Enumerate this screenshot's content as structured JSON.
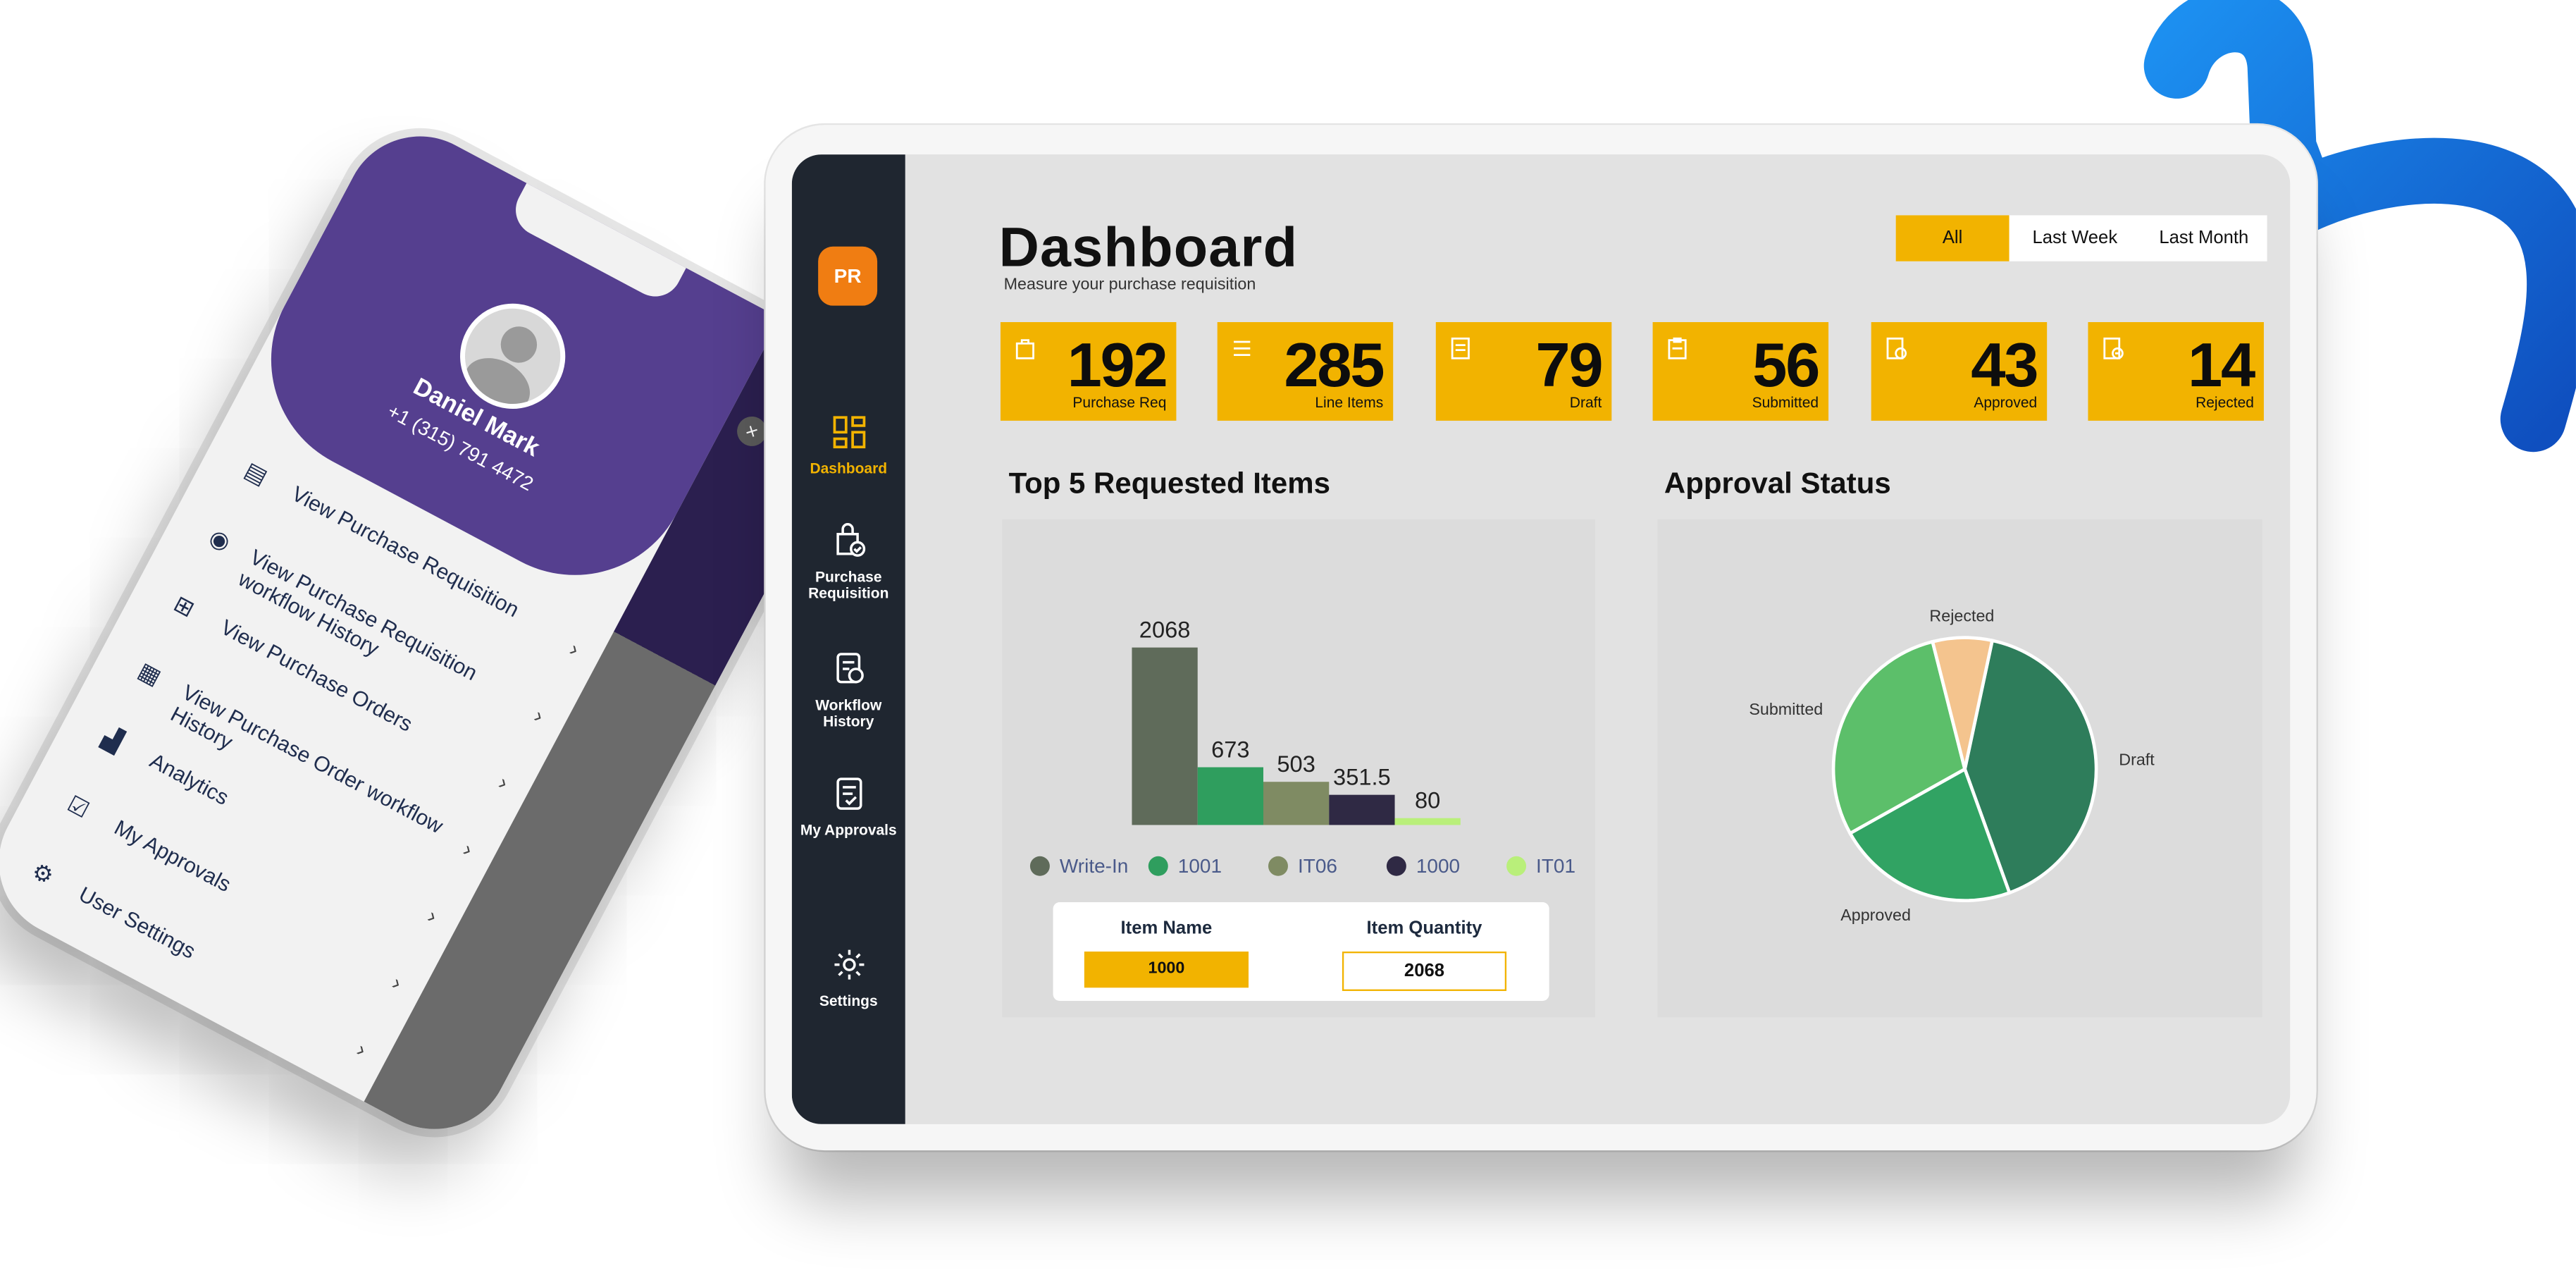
{
  "phone": {
    "user_name": "Daniel Mark",
    "user_phone": "+1 (315) 791 4472",
    "menu": [
      {
        "label": "View Purchase Requisition",
        "icon": "document-search-icon"
      },
      {
        "label": "View Purchase Requisition workflow History",
        "icon": "eye-icon"
      },
      {
        "label": "View Purchase Orders",
        "icon": "cart-icon"
      },
      {
        "label": "View Purchase Order workflow History",
        "icon": "receipt-icon"
      },
      {
        "label": "Analytics",
        "icon": "chart-icon"
      },
      {
        "label": "My Approvals",
        "icon": "approvals-icon"
      },
      {
        "label": "User Settings",
        "icon": "gear-icon"
      }
    ]
  },
  "tablet": {
    "logo": "PR",
    "nav": [
      {
        "label": "Dashboard",
        "icon": "dashboard-icon",
        "active": true
      },
      {
        "label": "Purchase Requisition",
        "icon": "bag-check-icon",
        "active": false
      },
      {
        "label": "Workflow History",
        "icon": "workflow-icon",
        "active": false
      },
      {
        "label": "My Approvals",
        "icon": "approvals-icon",
        "active": false
      },
      {
        "label": "Settings",
        "icon": "gear-icon",
        "active": false
      }
    ],
    "title": "Dashboard",
    "subtitle": "Measure your purchase requisition",
    "filters": [
      "All",
      "Last Week",
      "Last Month"
    ],
    "active_filter": "All",
    "kpis": [
      {
        "value": "192",
        "label": "Purchase Req"
      },
      {
        "value": "285",
        "label": "Line Items"
      },
      {
        "value": "79",
        "label": "Draft"
      },
      {
        "value": "56",
        "label": "Submitted"
      },
      {
        "value": "43",
        "label": "Approved"
      },
      {
        "value": "14",
        "label": "Rejected"
      }
    ],
    "bar_section_title": "Top 5 Requested Items",
    "pie_section_title": "Approval Status",
    "item_card": {
      "name_header": "Item Name",
      "qty_header": "Item Quantity",
      "name_value": "1000",
      "qty_value": "2068"
    }
  },
  "colors": {
    "accent": "#f2b300",
    "sidebar": "#1f2630",
    "logo": "#f07d12",
    "phone_header": "#553f8f"
  },
  "chart_data": [
    {
      "type": "bar",
      "categories": [
        "Write-In",
        "1001",
        "IT06",
        "1000",
        "IT01"
      ],
      "values": [
        2068,
        673,
        503,
        351.5,
        80
      ],
      "data_labels": [
        "2068",
        "673",
        "503",
        "351.5",
        "80"
      ],
      "colors": [
        "#5f6b5a",
        "#2f9e5e",
        "#7f8b63",
        "#2f2944",
        "#b9ef7a"
      ],
      "legend": "bottom"
    },
    {
      "type": "pie",
      "categories": [
        "Draft",
        "Approved",
        "Submitted",
        "Rejected"
      ],
      "values": [
        79,
        43,
        56,
        14
      ],
      "colors": [
        "#2e7d5b",
        "#31a363",
        "#5cbf6a",
        "#f4c48e"
      ]
    }
  ]
}
